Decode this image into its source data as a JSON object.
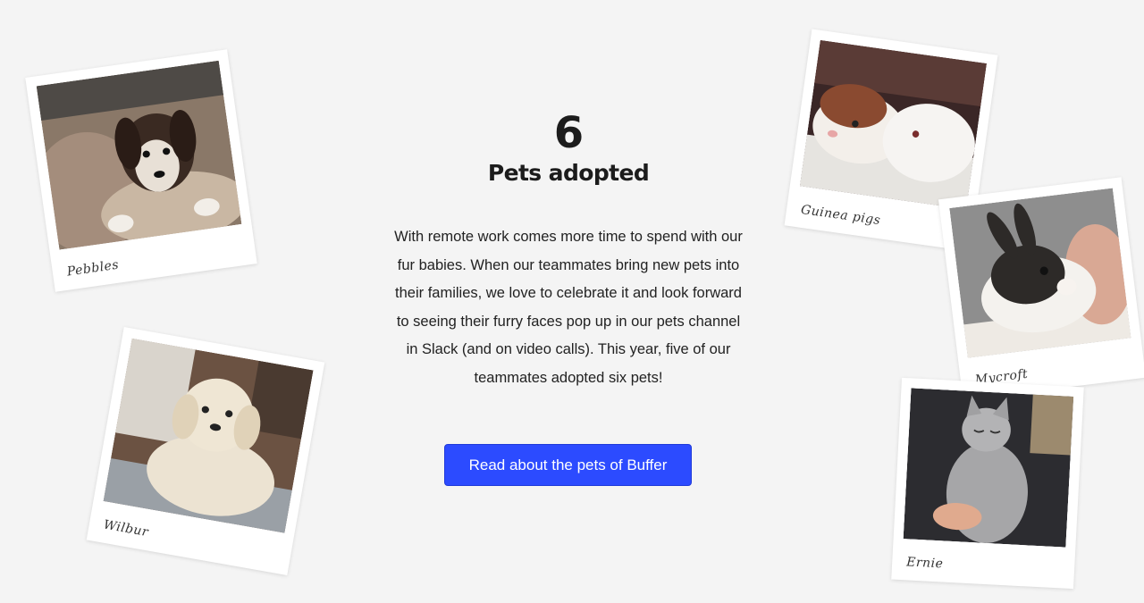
{
  "stat": {
    "number": "6",
    "label": "Pets adopted"
  },
  "description": "With remote work comes more time to spend with our fur babies. When our teammates bring new pets into their families, we love to celebrate it and look forward to seeing their furry faces pop up in our pets channel in Slack (and on video calls). This year, five of our teammates adopted six pets!",
  "cta": {
    "label": "Read about the pets of Buffer",
    "color": "#2c4bff"
  },
  "pets": [
    {
      "caption": "Pebbles",
      "icon": "dog-photo"
    },
    {
      "caption": "Wilbur",
      "icon": "dog-photo"
    },
    {
      "caption": "Guinea pigs",
      "icon": "guinea-pig-photo"
    },
    {
      "caption": "Mycroft",
      "icon": "rabbit-photo"
    },
    {
      "caption": "Ernie",
      "icon": "cat-photo"
    }
  ]
}
